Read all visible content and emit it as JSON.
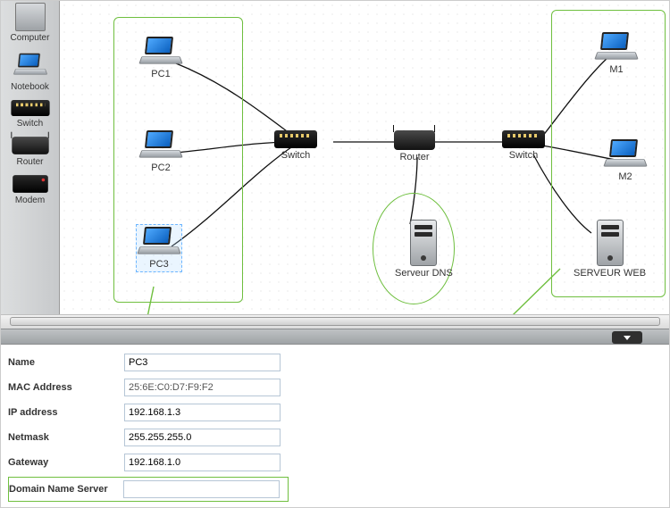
{
  "palette": [
    {
      "id": "computer",
      "label": "Computer"
    },
    {
      "id": "notebook",
      "label": "Notebook"
    },
    {
      "id": "switch",
      "label": "Switch"
    },
    {
      "id": "router",
      "label": "Router"
    },
    {
      "id": "modem",
      "label": "Modem"
    }
  ],
  "nodes": {
    "pc1": {
      "label": "PC1"
    },
    "pc2": {
      "label": "PC2"
    },
    "pc3": {
      "label": "PC3"
    },
    "sw1": {
      "label": "Switch"
    },
    "rtr": {
      "label": "Router"
    },
    "sw2": {
      "label": "Switch"
    },
    "m1": {
      "label": "M1"
    },
    "m2": {
      "label": "M2"
    },
    "dns": {
      "label": "Serveur DNS"
    },
    "web": {
      "label": "SERVEUR WEB"
    }
  },
  "properties": {
    "labels": {
      "name": "Name",
      "mac": "MAC Address",
      "ip": "IP address",
      "mask": "Netmask",
      "gw": "Gateway",
      "dns": "Domain Name Server"
    },
    "values": {
      "name": "PC3",
      "mac": "25:6E:C0:D7:F9:F2",
      "ip": "192.168.1.3",
      "mask": "255.255.255.0",
      "gw": "192.168.1.0",
      "dns": ""
    }
  }
}
